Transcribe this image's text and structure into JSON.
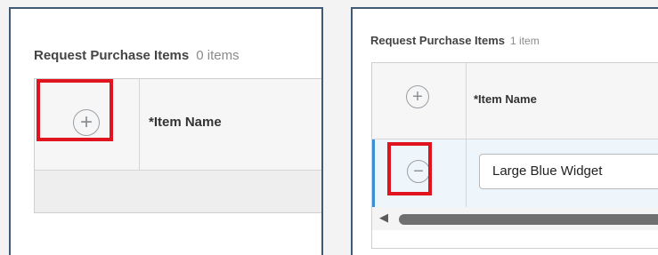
{
  "left": {
    "title": "Request Purchase Items",
    "count": "0 items",
    "column_header": "*Item Name",
    "add_icon": "plus-circle-icon"
  },
  "right": {
    "title": "Request Purchase Items",
    "count": "1 item",
    "column_header": "*Item Name",
    "add_icon": "plus-circle-icon",
    "remove_icon": "minus-circle-icon",
    "rows": [
      {
        "item_name": "Large Blue Widget"
      }
    ]
  },
  "glyphs": {
    "plus": "+",
    "minus": "−",
    "scroll_left": "◀"
  },
  "colors": {
    "highlight": "#e0141e",
    "panel_border": "#3f5a74",
    "selected_row": "#3b8ed8",
    "scroll_thumb": "#6f6f6f"
  }
}
